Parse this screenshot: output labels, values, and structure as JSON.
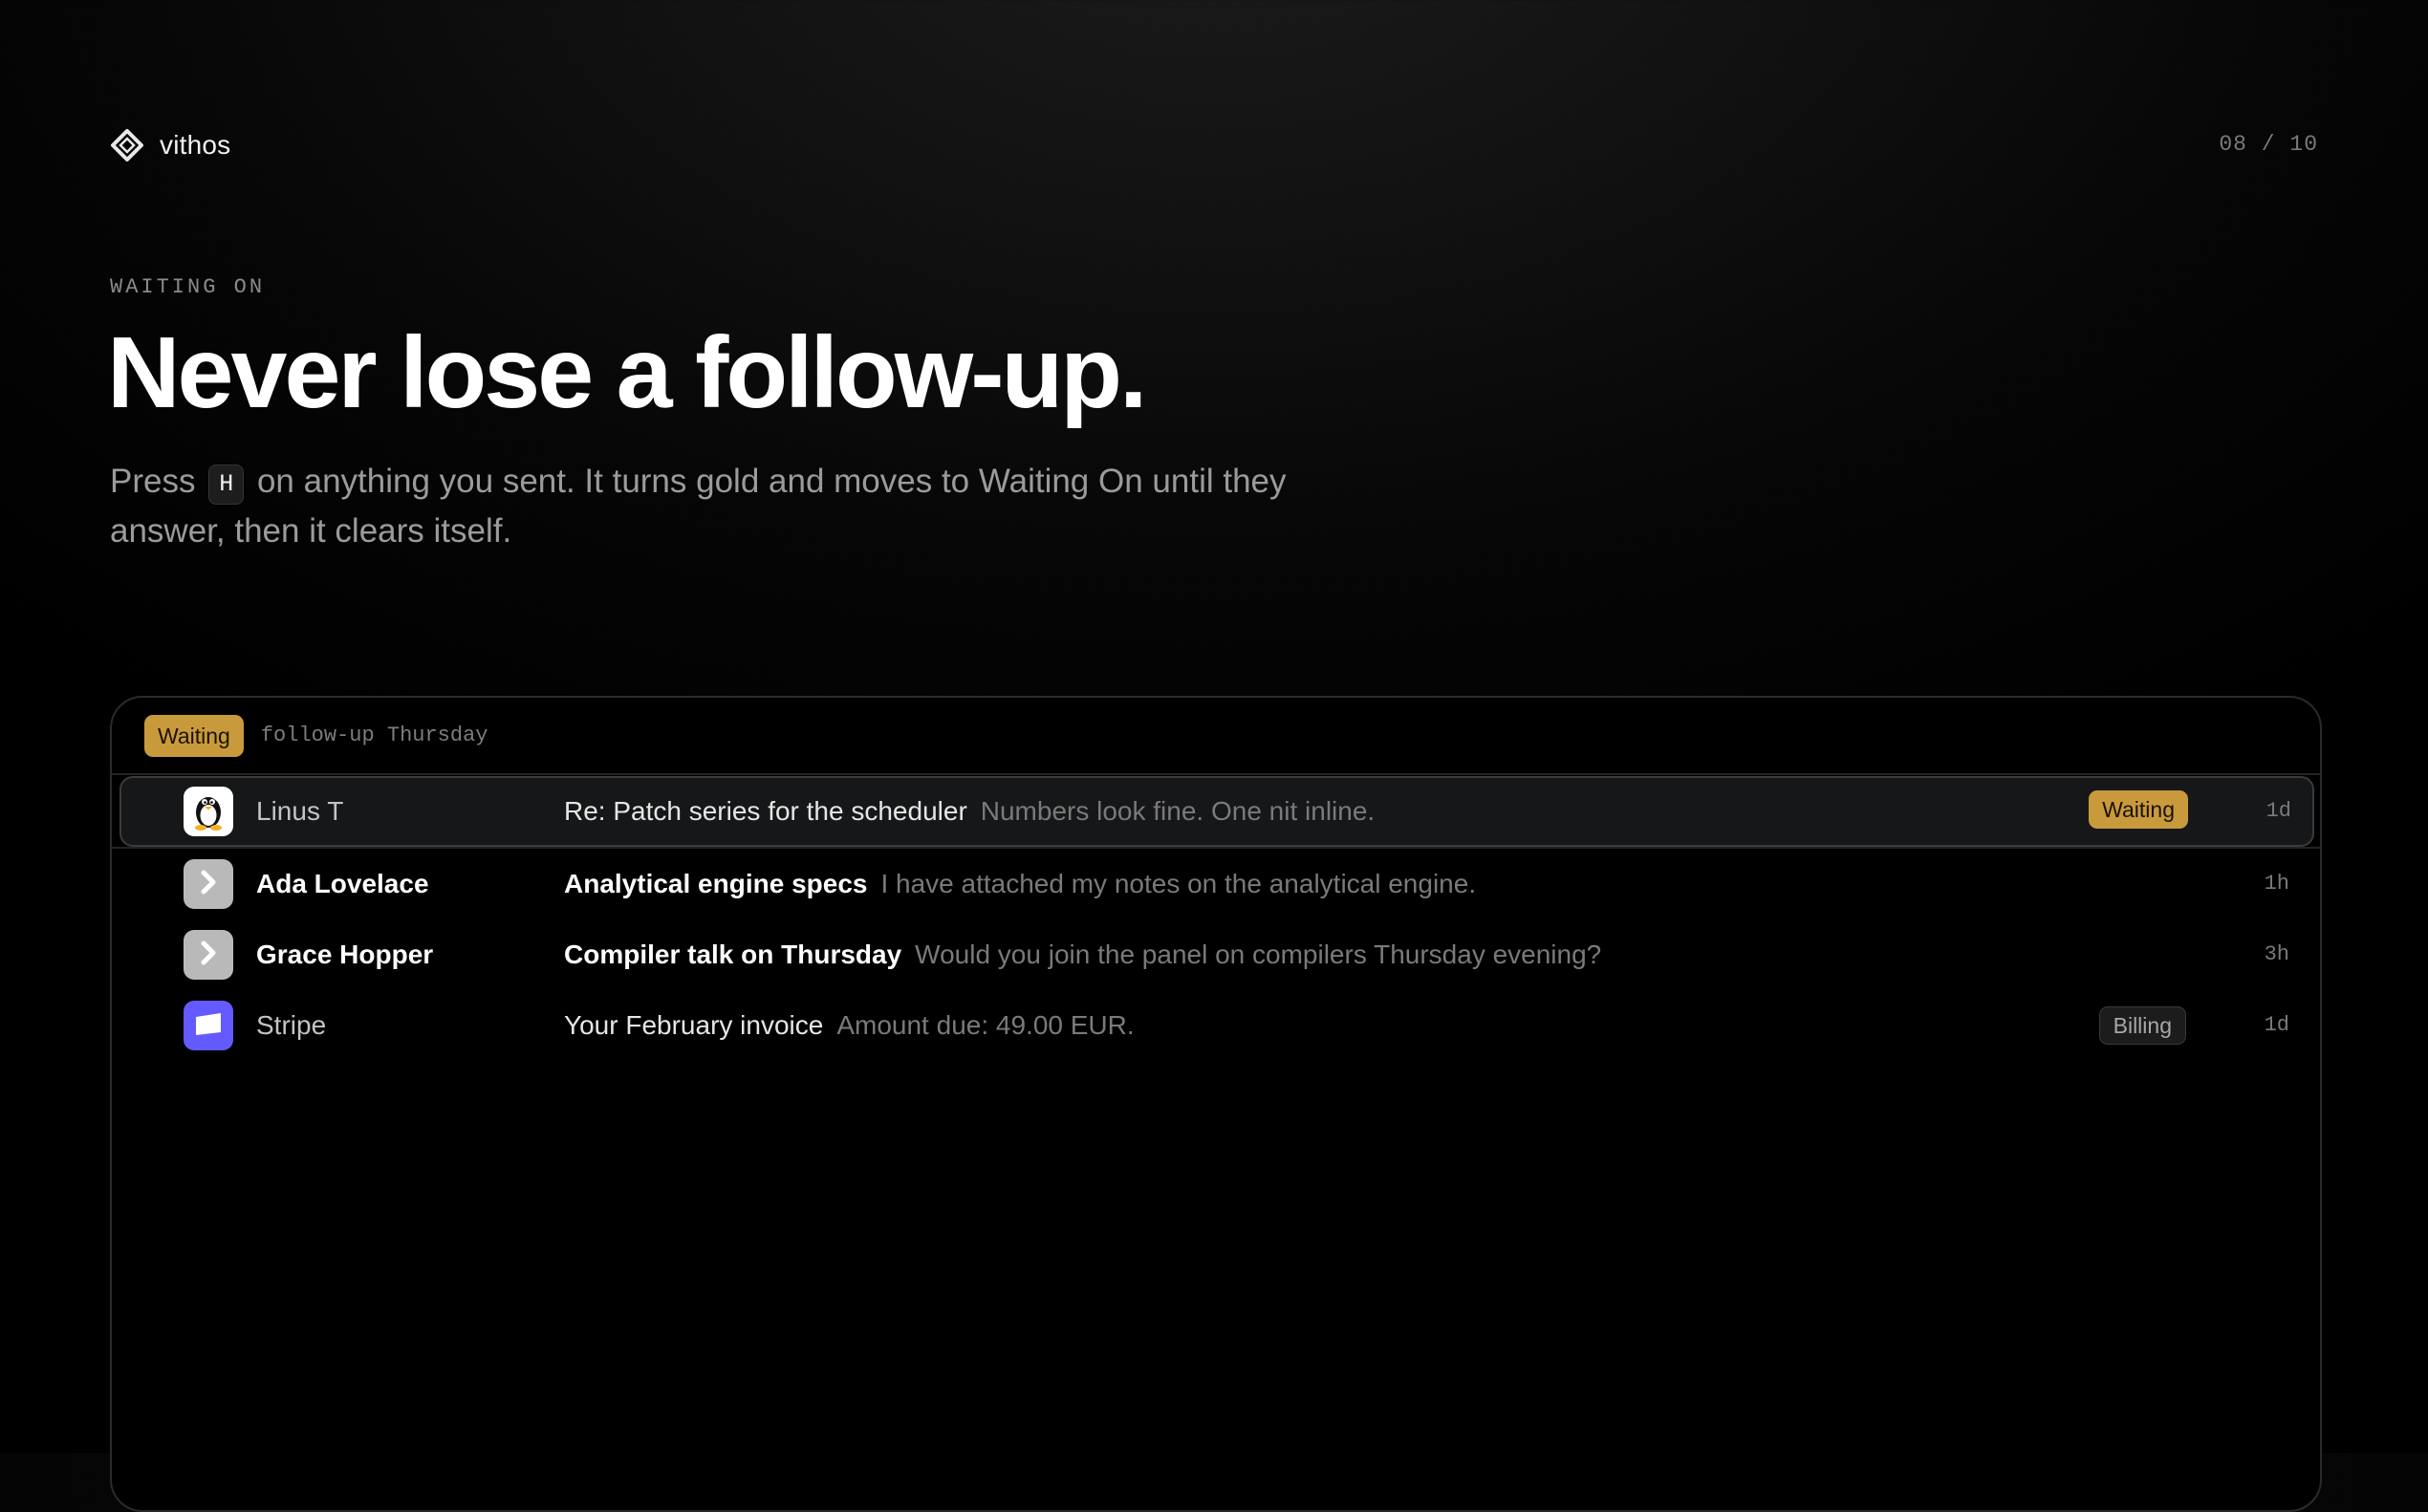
{
  "brand": {
    "name": "vithos",
    "icon": "diamond-logo-icon"
  },
  "pager": "08 / 10",
  "eyebrow": "WAITING ON",
  "headline": "Never lose a follow-up.",
  "subcopy": {
    "before": "Press",
    "key": "H",
    "after": "on anything you sent. It turns gold and moves to Waiting On until they answer, then it clears itself."
  },
  "panel": {
    "filter_chip": "Waiting",
    "filter_note": "follow-up Thursday",
    "rows": [
      {
        "sender": "Linus T",
        "subject": "Re: Patch series for the scheduler",
        "preview": "Numbers look fine. One nit inline.",
        "tag": "Waiting",
        "time": "1d",
        "avatar_icon": "penguin-icon",
        "selected": true,
        "unread": false
      },
      {
        "sender": "Ada Lovelace",
        "subject": "Analytical engine specs",
        "preview": "I have attached my notes on the analytical engine.",
        "tag": "",
        "time": "1h",
        "avatar_icon": "chevron-right-icon",
        "selected": false,
        "unread": true
      },
      {
        "sender": "Grace Hopper",
        "subject": "Compiler talk on Thursday",
        "preview": "Would you join the panel on compilers Thursday evening?",
        "tag": "",
        "time": "3h",
        "avatar_icon": "chevron-right-icon",
        "selected": false,
        "unread": true
      },
      {
        "sender": "Stripe",
        "subject": "Your February invoice",
        "preview": "Amount due: 49.00 EUR.",
        "tag": "Billing",
        "time": "1d",
        "avatar_icon": "stripe-logo-icon",
        "selected": false,
        "unread": false
      }
    ]
  },
  "colors": {
    "accent_gold": "#c99a3c",
    "stripe_purple": "#635bff",
    "background": "#000000"
  }
}
